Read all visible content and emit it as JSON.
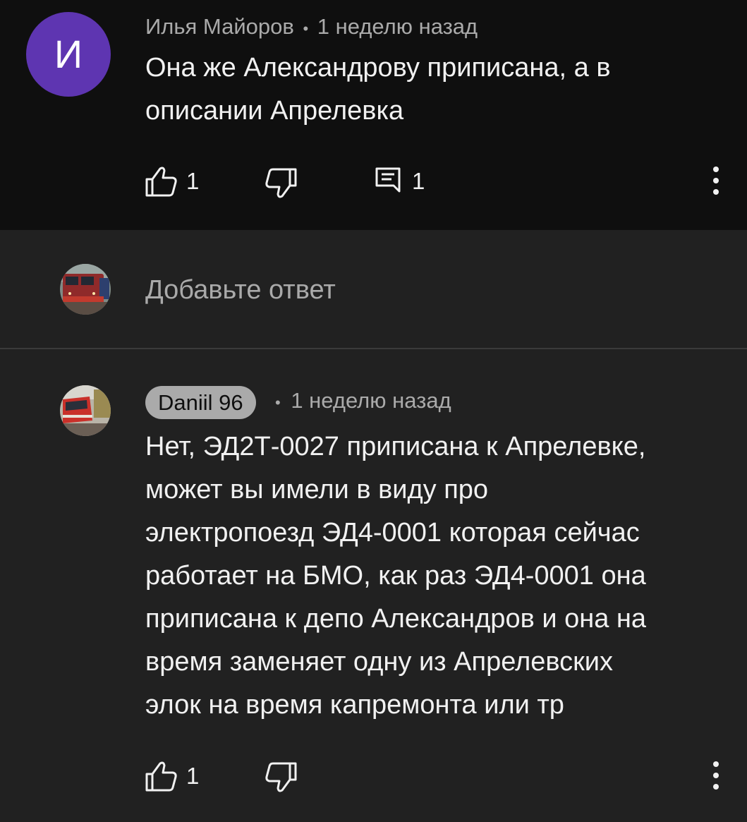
{
  "comment1": {
    "avatar_letter": "И",
    "author": "Илья Майоров",
    "separator": "•",
    "time": "1 неделю назад",
    "text_lines": [
      "Она же Александрову приписана, а в",
      "описании Апрелевка"
    ],
    "like_count": "1",
    "reply_count": "1"
  },
  "reply_input": {
    "placeholder": "Добавьте ответ"
  },
  "comment2": {
    "author": "Daniil 96",
    "separator": "•",
    "time": "1 неделю назад",
    "text_lines": [
      "Нет, ЭД2Т-0027 приписана к Апрелевке,",
      "может вы имели в виду про",
      "электропоезд ЭД4-0001 которая сейчас",
      "работает на БМО, как раз ЭД4-0001 она",
      "приписана к депо Александров и она на",
      "время заменяет одну из Апрелевских",
      "элок на время капремонта или тр"
    ],
    "like_count": "1"
  },
  "icons": {
    "like": "thumbs-up-icon",
    "dislike": "thumbs-down-icon",
    "reply": "comment-icon",
    "more": "more-vert-icon"
  },
  "colors": {
    "top_background": "#0f0f0f",
    "background": "#212121",
    "avatar_purple": "#5e35b1",
    "secondary_text": "#aaaaaa"
  }
}
